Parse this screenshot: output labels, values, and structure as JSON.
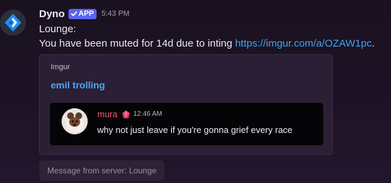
{
  "message": {
    "author": "Dyno",
    "badge_label": "APP",
    "timestamp": "5:43 PM",
    "line1": "Lounge:",
    "line2_text": "You have been muted for 14d due to inting ",
    "line2_link": "https://imgur.com/a/OZAW1pc",
    "line2_suffix": "."
  },
  "embed": {
    "provider": "Imgur",
    "title": "emil trolling",
    "quote": {
      "author": "mura",
      "timestamp": "12:46 AM",
      "text": "why not just leave if you're gonna grief every race",
      "role_icon": "pink-gem-icon",
      "author_color": "#e85a7a"
    }
  },
  "footer": {
    "server_message": "Message from server: Lounge"
  },
  "colors": {
    "link": "#3fa4f5",
    "badge": "#5865f2",
    "embed_title": "#4ea6f7"
  },
  "icons": {
    "bot_avatar": "dyno-logo-icon",
    "badge_check": "checkmark-icon",
    "quote_avatar": "user-avatar"
  }
}
